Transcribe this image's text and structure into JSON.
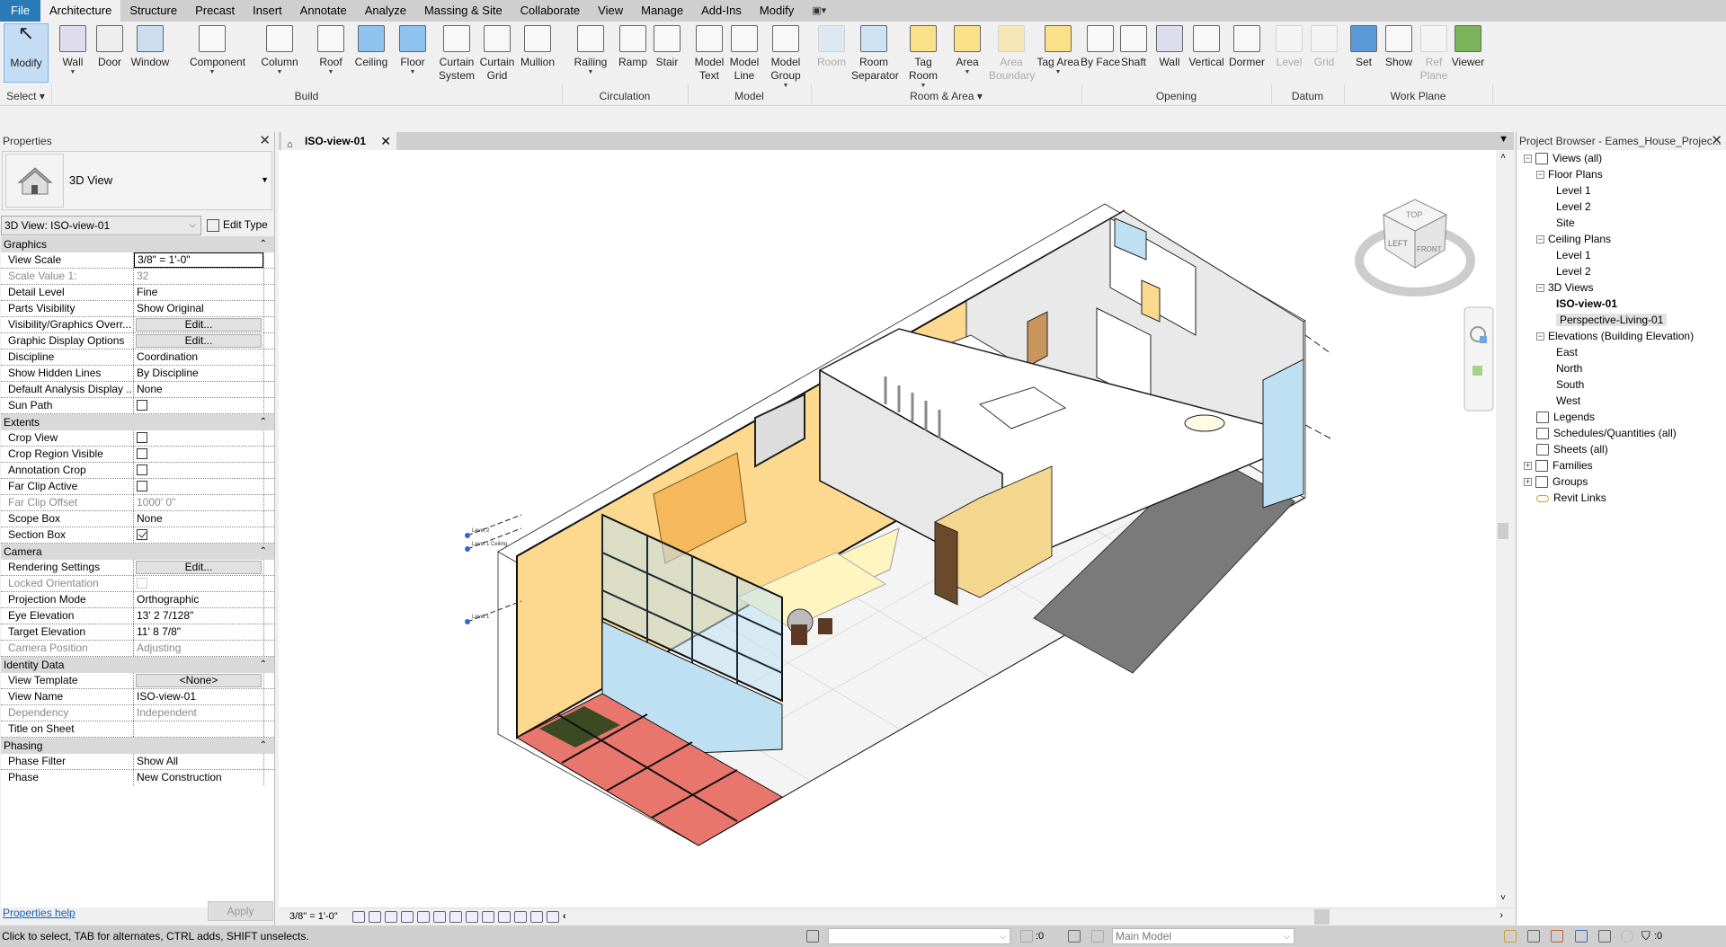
{
  "menu_tabs": [
    "File",
    "Architecture",
    "Structure",
    "Precast",
    "Insert",
    "Annotate",
    "Analyze",
    "Massing & Site",
    "Collaborate",
    "View",
    "Manage",
    "Add-Ins",
    "Modify"
  ],
  "menu_active": "Architecture",
  "menu_extra_icon": "contextual-tab-toggle-icon",
  "ribbon": {
    "panels": [
      {
        "label": "Select",
        "dropdown": true
      },
      {
        "label": "Build"
      },
      {
        "label": "Circulation"
      },
      {
        "label": "Model"
      },
      {
        "label": "Room & Area",
        "dropdown": true
      },
      {
        "label": "Opening"
      },
      {
        "label": "Datum"
      },
      {
        "label": "Work Plane"
      }
    ],
    "buttons": [
      {
        "label": "Modify",
        "icon": "cursor-arrow-icon",
        "selected": true
      },
      {
        "label": "Wall",
        "icon": "wall-icon",
        "dropdown": true
      },
      {
        "label": "Door",
        "icon": "door-icon"
      },
      {
        "label": "Window",
        "icon": "window-icon"
      },
      {
        "label": "Component",
        "icon": "component-icon",
        "dropdown": true
      },
      {
        "label": "Column",
        "icon": "column-icon",
        "dropdown": true
      },
      {
        "label": "Roof",
        "icon": "roof-icon",
        "dropdown": true
      },
      {
        "label": "Ceiling",
        "icon": "ceiling-icon"
      },
      {
        "label": "Floor",
        "icon": "floor-icon",
        "dropdown": true
      },
      {
        "label": "Curtain System",
        "icon": "curtain-system-icon"
      },
      {
        "label": "Curtain Grid",
        "icon": "curtain-grid-icon"
      },
      {
        "label": "Mullion",
        "icon": "mullion-icon"
      },
      {
        "label": "Railing",
        "icon": "railing-icon",
        "dropdown": true
      },
      {
        "label": "Ramp",
        "icon": "ramp-icon"
      },
      {
        "label": "Stair",
        "icon": "stair-icon"
      },
      {
        "label": "Model Text",
        "icon": "model-text-icon"
      },
      {
        "label": "Model Line",
        "icon": "model-line-icon"
      },
      {
        "label": "Model Group",
        "icon": "model-group-icon",
        "dropdown": true
      },
      {
        "label": "Room",
        "icon": "room-icon",
        "disabled": true
      },
      {
        "label": "Room Separator",
        "icon": "room-separator-icon"
      },
      {
        "label": "Tag Room",
        "icon": "tag-room-icon",
        "dropdown": true
      },
      {
        "label": "Area",
        "icon": "area-icon",
        "dropdown": true
      },
      {
        "label": "Area Boundary",
        "icon": "area-boundary-icon",
        "disabled": true
      },
      {
        "label": "Tag Area",
        "icon": "tag-area-icon",
        "dropdown": true
      },
      {
        "label": "By Face",
        "icon": "opening-by-face-icon"
      },
      {
        "label": "Shaft",
        "icon": "shaft-icon"
      },
      {
        "label": "Wall",
        "icon": "wall-opening-icon"
      },
      {
        "label": "Vertical",
        "icon": "vertical-opening-icon"
      },
      {
        "label": "Dormer",
        "icon": "dormer-icon"
      },
      {
        "label": "Level",
        "icon": "level-icon",
        "disabled": true
      },
      {
        "label": "Grid",
        "icon": "grid-icon",
        "disabled": true
      },
      {
        "label": "Set",
        "icon": "set-work-plane-icon"
      },
      {
        "label": "Show",
        "icon": "show-work-plane-icon"
      },
      {
        "label": "Ref Plane",
        "icon": "ref-plane-icon",
        "disabled": true
      },
      {
        "label": "Viewer",
        "icon": "viewer-icon"
      }
    ]
  },
  "properties": {
    "title": "Properties",
    "type_name": "3D View",
    "type_icon": "house-3d-view-icon",
    "view_selector": "3D View: ISO-view-01",
    "edit_type": "Edit Type",
    "sections": [
      {
        "name": "Graphics",
        "rows": [
          {
            "label": "View Scale",
            "value": "3/8\" = 1'-0\"",
            "kind": "field"
          },
          {
            "label": "Scale Value    1:",
            "value": "32",
            "readonly": true
          },
          {
            "label": "Detail Level",
            "value": "Fine"
          },
          {
            "label": "Parts Visibility",
            "value": "Show Original"
          },
          {
            "label": "Visibility/Graphics Overr...",
            "value": "Edit...",
            "kind": "button"
          },
          {
            "label": "Graphic Display Options",
            "value": "Edit...",
            "kind": "button"
          },
          {
            "label": "Discipline",
            "value": "Coordination"
          },
          {
            "label": "Show Hidden Lines",
            "value": "By Discipline"
          },
          {
            "label": "Default Analysis Display ...",
            "value": "None"
          },
          {
            "label": "Sun Path",
            "kind": "checkbox",
            "checked": false
          }
        ]
      },
      {
        "name": "Extents",
        "rows": [
          {
            "label": "Crop View",
            "kind": "checkbox",
            "checked": false
          },
          {
            "label": "Crop Region Visible",
            "kind": "checkbox",
            "checked": false
          },
          {
            "label": "Annotation Crop",
            "kind": "checkbox",
            "checked": false
          },
          {
            "label": "Far Clip Active",
            "kind": "checkbox",
            "checked": false
          },
          {
            "label": "Far Clip Offset",
            "value": "1000'  0\"",
            "readonly": true
          },
          {
            "label": "Scope Box",
            "value": "None"
          },
          {
            "label": "Section Box",
            "kind": "checkbox",
            "checked": true
          }
        ]
      },
      {
        "name": "Camera",
        "rows": [
          {
            "label": "Rendering Settings",
            "value": "Edit...",
            "kind": "button"
          },
          {
            "label": "Locked Orientation",
            "kind": "checkbox",
            "checked": false,
            "readonly": true
          },
          {
            "label": "Projection Mode",
            "value": "Orthographic"
          },
          {
            "label": "Eye Elevation",
            "value": "13'  2 7/128\""
          },
          {
            "label": "Target Elevation",
            "value": "11'  8 7/8\""
          },
          {
            "label": "Camera Position",
            "value": "Adjusting",
            "readonly": true
          }
        ]
      },
      {
        "name": "Identity Data",
        "rows": [
          {
            "label": "View Template",
            "value": "<None>",
            "kind": "button"
          },
          {
            "label": "View Name",
            "value": "ISO-view-01"
          },
          {
            "label": "Dependency",
            "value": "Independent",
            "readonly": true
          },
          {
            "label": "Title on Sheet",
            "value": ""
          }
        ]
      },
      {
        "name": "Phasing",
        "rows": [
          {
            "label": "Phase Filter",
            "value": "Show All"
          },
          {
            "label": "Phase",
            "value": "New Construction"
          }
        ]
      }
    ],
    "help_link": "Properties help",
    "apply": "Apply"
  },
  "view": {
    "tab_title": "ISO-view-01",
    "scale": "3/8\" = 1'-0\"",
    "viewcube_faces": {
      "top": "TOP",
      "left": "LEFT",
      "front": "FRONT"
    },
    "level_markers": [
      "Level 2",
      "Level 1 Ceiling",
      "Level 1"
    ]
  },
  "project_browser": {
    "title": "Project Browser - Eames_House_Projec...",
    "tree": [
      {
        "label": "Views (all)",
        "depth": 0,
        "toggle": "-",
        "icon": "views-icon"
      },
      {
        "label": "Floor Plans",
        "depth": 1,
        "toggle": "-"
      },
      {
        "label": "Level 1",
        "depth": 2
      },
      {
        "label": "Level 2",
        "depth": 2
      },
      {
        "label": "Site",
        "depth": 2
      },
      {
        "label": "Ceiling Plans",
        "depth": 1,
        "toggle": "-"
      },
      {
        "label": "Level 1",
        "depth": 2
      },
      {
        "label": "Level 2",
        "depth": 2
      },
      {
        "label": "3D Views",
        "depth": 1,
        "toggle": "-"
      },
      {
        "label": "ISO-view-01",
        "depth": 2,
        "bold": true
      },
      {
        "label": "Perspective-Living-01",
        "depth": 2,
        "highlight": true
      },
      {
        "label": "Elevations (Building Elevation)",
        "depth": 1,
        "toggle": "-"
      },
      {
        "label": "East",
        "depth": 2
      },
      {
        "label": "North",
        "depth": 2
      },
      {
        "label": "South",
        "depth": 2
      },
      {
        "label": "West",
        "depth": 2
      },
      {
        "label": "Legends",
        "depth": 0,
        "icon": "legends-icon"
      },
      {
        "label": "Schedules/Quantities (all)",
        "depth": 0,
        "icon": "schedules-icon"
      },
      {
        "label": "Sheets (all)",
        "depth": 0,
        "icon": "sheets-icon"
      },
      {
        "label": "Families",
        "depth": 0,
        "toggle": "+",
        "icon": "families-icon"
      },
      {
        "label": "Groups",
        "depth": 0,
        "toggle": "+",
        "icon": "groups-icon"
      },
      {
        "label": "Revit Links",
        "depth": 0,
        "icon": "revit-links-icon"
      }
    ]
  },
  "status": {
    "message": "Click to select, TAB for alternates, CTRL adds, SHIFT unselects.",
    "workset_count": ":0",
    "design_option": "Main Model",
    "filter_count": ":0"
  },
  "colors": {
    "accent": "#2a7ab8",
    "wall_yellow": "#fcd98f",
    "patio": "#e9766c",
    "glass": "#bfe0f3"
  }
}
